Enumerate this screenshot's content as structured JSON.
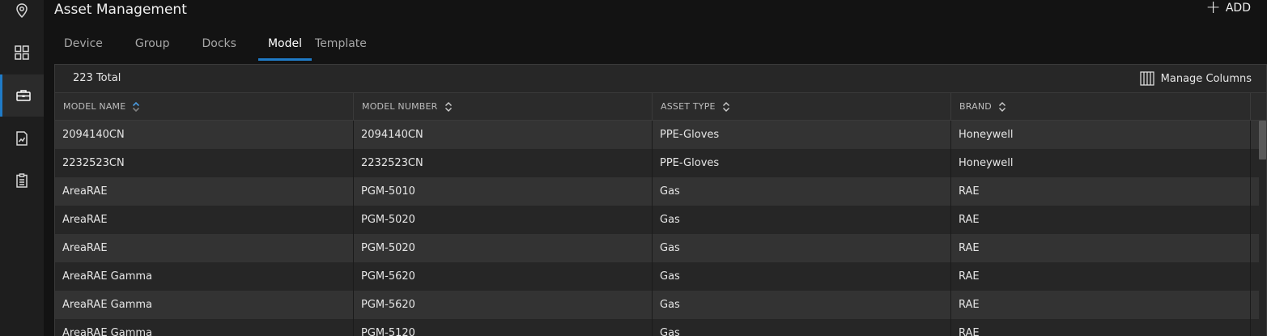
{
  "header": {
    "title": "Asset Management",
    "add_label": "ADD"
  },
  "sidebar": {
    "items": [
      {
        "icon": "location-pin-icon"
      },
      {
        "icon": "dashboard-grid-icon"
      },
      {
        "icon": "toolbox-icon",
        "active": true
      },
      {
        "icon": "report-chart-icon"
      },
      {
        "icon": "clipboard-icon"
      }
    ]
  },
  "tabs": [
    {
      "label": "Device"
    },
    {
      "label": "Group"
    },
    {
      "label": "Docks"
    },
    {
      "label": "Model",
      "active": true
    },
    {
      "label": "Template"
    }
  ],
  "grid": {
    "total": "223 Total",
    "manage_columns_label": "Manage Columns",
    "columns": [
      "MODEL NAME",
      "MODEL NUMBER",
      "ASSET TYPE",
      "BRAND"
    ],
    "rows": [
      [
        "2094140CN",
        "2094140CN",
        "PPE-Gloves",
        "Honeywell"
      ],
      [
        "2232523CN",
        "2232523CN",
        "PPE-Gloves",
        "Honeywell"
      ],
      [
        "AreaRAE",
        "PGM-5010",
        "Gas",
        "RAE"
      ],
      [
        "AreaRAE",
        "PGM-5020",
        "Gas",
        "RAE"
      ],
      [
        "AreaRAE",
        "PGM-5020",
        "Gas",
        "RAE"
      ],
      [
        "AreaRAE Gamma",
        "PGM-5620",
        "Gas",
        "RAE"
      ],
      [
        "AreaRAE Gamma",
        "PGM-5620",
        "Gas",
        "RAE"
      ],
      [
        "AreaRAE Gamma",
        "PGM-5120",
        "Gas",
        "RAE"
      ]
    ]
  },
  "colors": {
    "accent": "#1f7bc7",
    "background": "#131313",
    "row_odd": "#333333",
    "row_even": "#262626"
  }
}
